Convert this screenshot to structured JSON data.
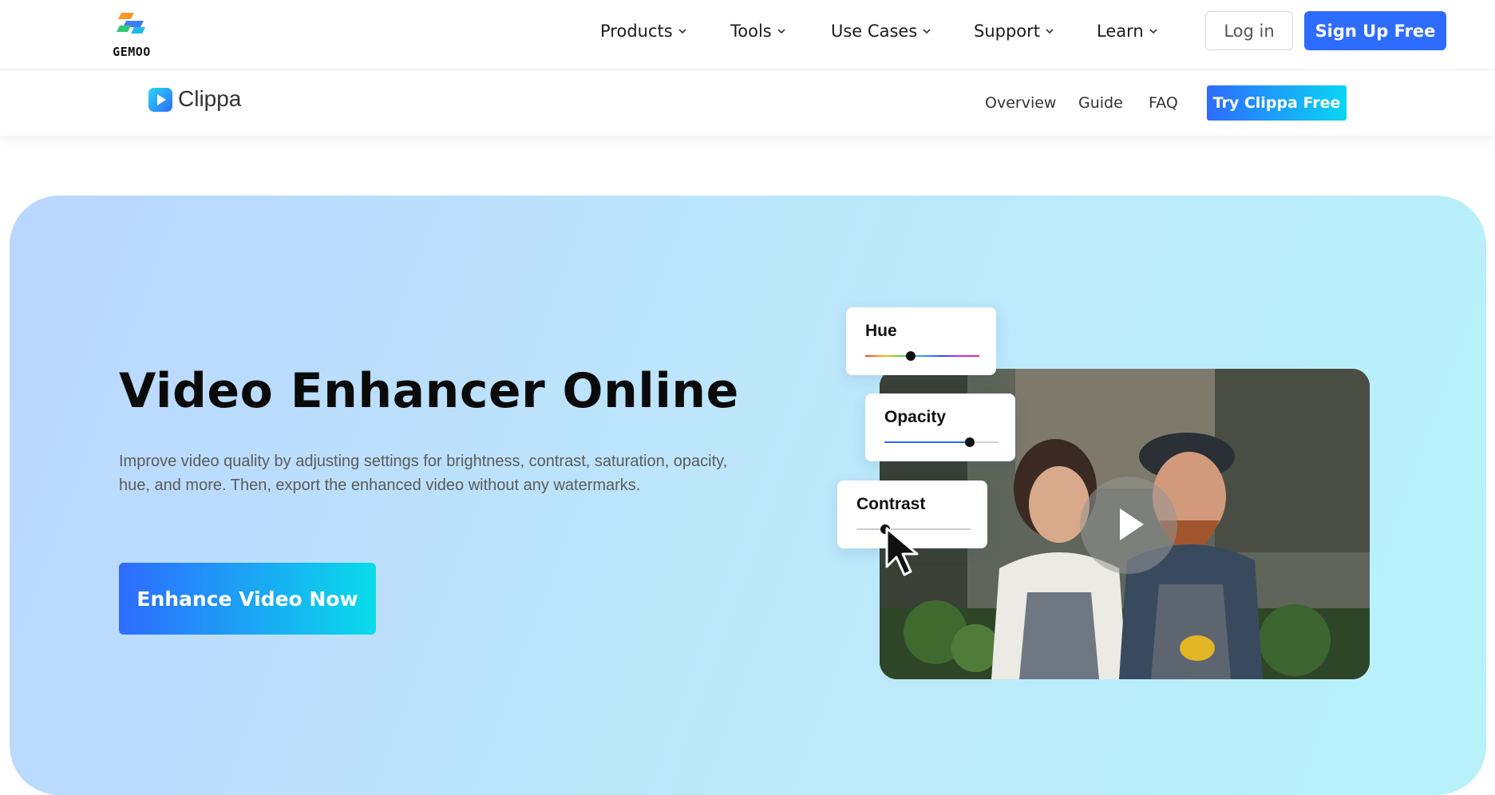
{
  "brand": {
    "logo_text": "GEMOO"
  },
  "topnav": {
    "menu": [
      {
        "label": "Products"
      },
      {
        "label": "Tools"
      },
      {
        "label": "Use Cases"
      },
      {
        "label": "Support"
      },
      {
        "label": "Learn"
      }
    ],
    "login_label": "Log in",
    "signup_label": "Sign Up Free"
  },
  "subnav": {
    "product_name": "Clippa",
    "links": [
      {
        "label": "Overview"
      },
      {
        "label": "Guide"
      },
      {
        "label": "FAQ"
      }
    ],
    "try_label": "Try Clippa Free"
  },
  "hero": {
    "title": "Video Enhancer Online",
    "description": "Improve video quality by adjusting settings for brightness, contrast, saturation, opacity, hue, and more. Then, export the enhanced video without any watermarks.",
    "cta_label": "Enhance Video Now"
  },
  "sliders": [
    {
      "label": "Hue",
      "value": 0.4
    },
    {
      "label": "Opacity",
      "value": 0.75
    },
    {
      "label": "Contrast",
      "value": 0.25
    }
  ],
  "icons": [
    "gemoo-logo-icon",
    "chevron-down-icon",
    "clippa-logo-icon",
    "play-icon",
    "cursor-arrow-icon"
  ],
  "colors": {
    "primary": "#2e6bff",
    "accent": "#09d6f2",
    "hero_bg_start": "#b9d6ff",
    "hero_bg_end": "#b7f2fb"
  }
}
